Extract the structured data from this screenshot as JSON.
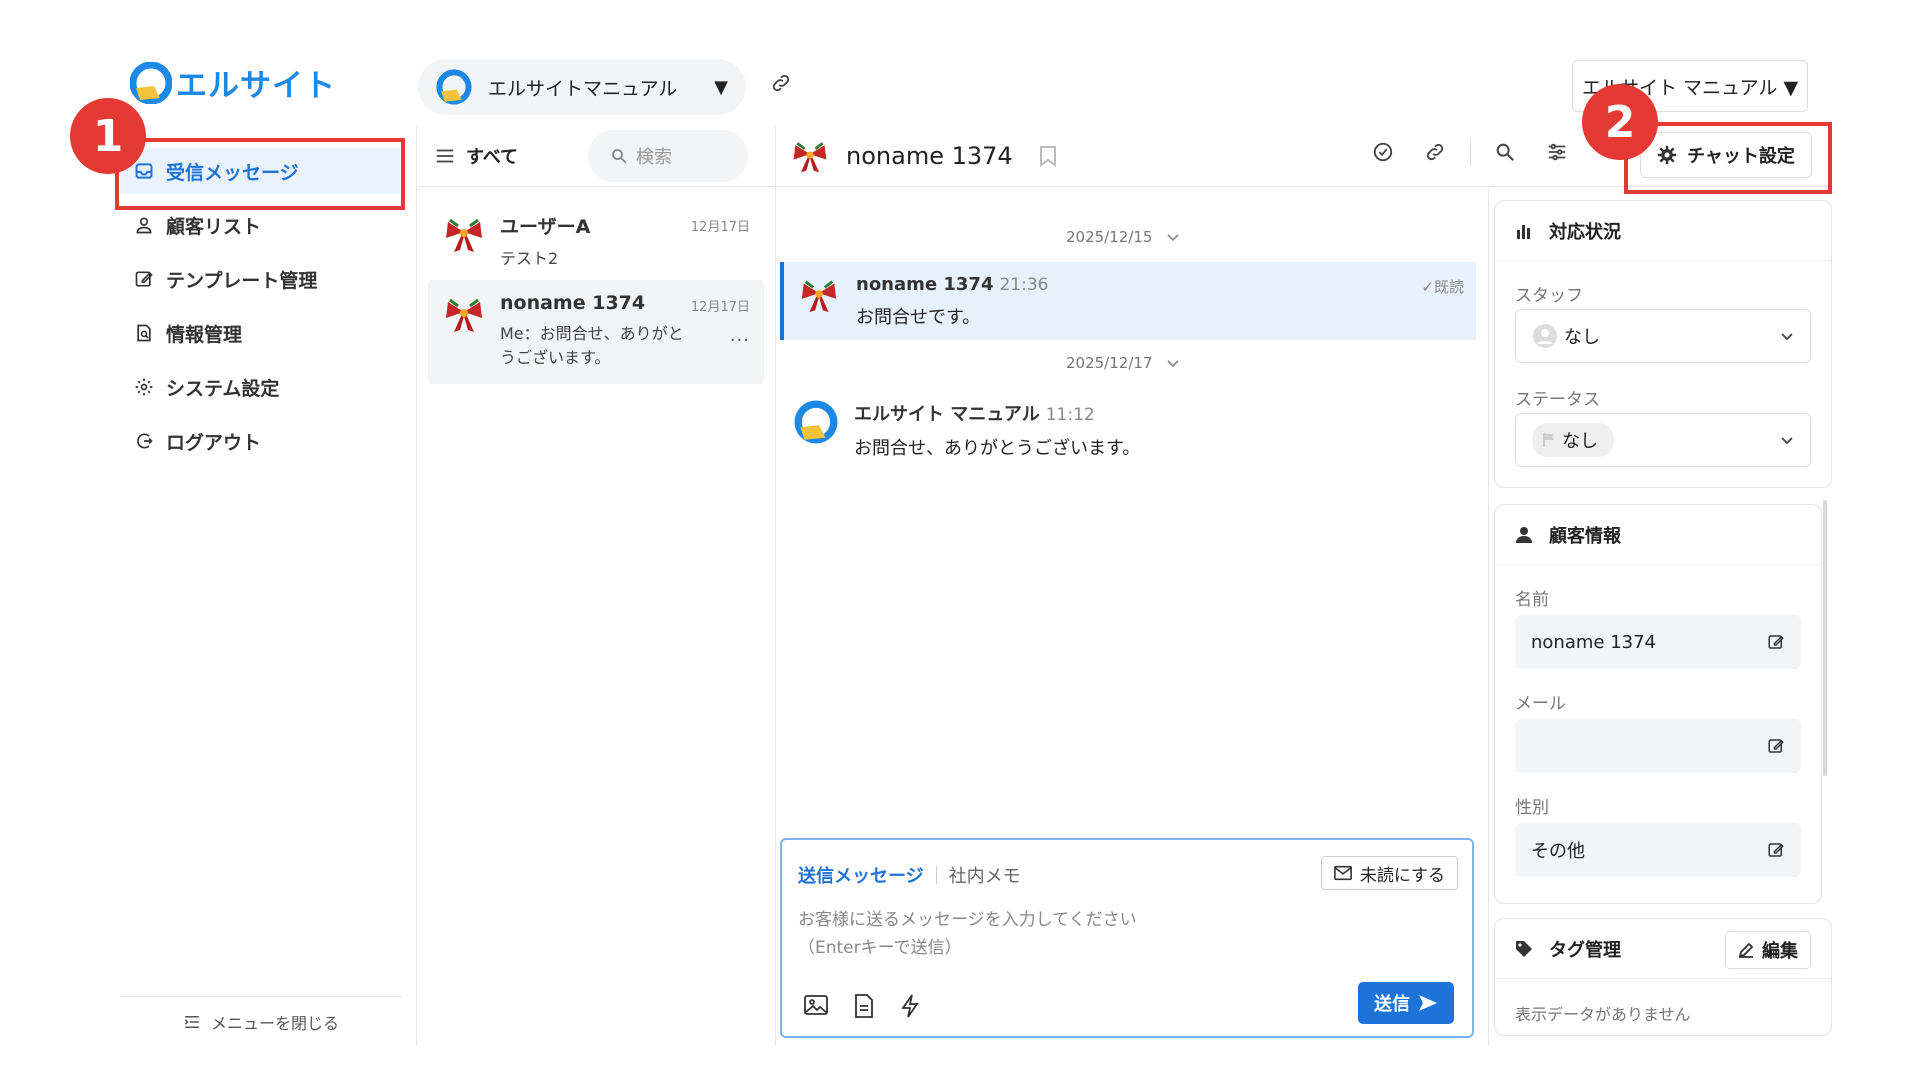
{
  "app": {
    "logo_text": "エルサイト",
    "brand_color": "#1e88e5"
  },
  "topbar": {
    "account_name": "エルサイトマニュアル",
    "user_menu": "エルサイト マニュアル ▼"
  },
  "sidebar": {
    "items": [
      {
        "label": "受信メッセージ",
        "icon": "inbox-icon",
        "active": true
      },
      {
        "label": "顧客リスト",
        "icon": "user-icon"
      },
      {
        "label": "テンプレート管理",
        "icon": "edit-icon"
      },
      {
        "label": "情報管理",
        "icon": "document-search-icon"
      },
      {
        "label": "システム設定",
        "icon": "gear-icon"
      },
      {
        "label": "ログアウト",
        "icon": "logout-icon"
      }
    ],
    "close_menu": "メニューを閉じる"
  },
  "list": {
    "filter": "すべて",
    "search_placeholder": "検索",
    "conversations": [
      {
        "name": "ユーザーA",
        "date": "12月17日",
        "preview": "テスト2"
      },
      {
        "name": "noname 1374",
        "date": "12月17日",
        "preview": "Me：お問合せ、ありがとうございます。",
        "more": "···"
      }
    ]
  },
  "chat": {
    "title": "noname 1374",
    "settings_button": "チャット設定",
    "messages": [
      {
        "date": "2025/12/15",
        "sender": "noname 1374",
        "time": "21:36",
        "text": "お問合せです。",
        "read": "✓既読"
      },
      {
        "date": "2025/12/17",
        "sender": "エルサイト マニュアル",
        "time": "11:12",
        "text": "お問合せ、ありがとうございます。"
      }
    ],
    "composer": {
      "tab_send": "送信メッセージ",
      "tab_memo": "社内メモ",
      "mark_unread": "未読にする",
      "placeholder_line1": "お客様に送るメッセージを入力してください",
      "placeholder_line2": "（Enterキーで送信）",
      "send": "送信"
    }
  },
  "annotations": {
    "badge1": "1",
    "badge2": "2",
    "highlight_color": "#e53935"
  },
  "right_panel": {
    "status_card": {
      "title": "対応状況",
      "staff_label": "スタッフ",
      "staff_value": "なし",
      "status_label": "ステータス",
      "status_value": "なし"
    },
    "customer_card": {
      "title": "顧客情報",
      "name_label": "名前",
      "name_value": "noname 1374",
      "email_label": "メール",
      "email_value": "",
      "gender_label": "性別",
      "gender_value": "その他"
    },
    "tag_card": {
      "title": "タグ管理",
      "edit": "編集",
      "empty": "表示データがありません"
    }
  }
}
